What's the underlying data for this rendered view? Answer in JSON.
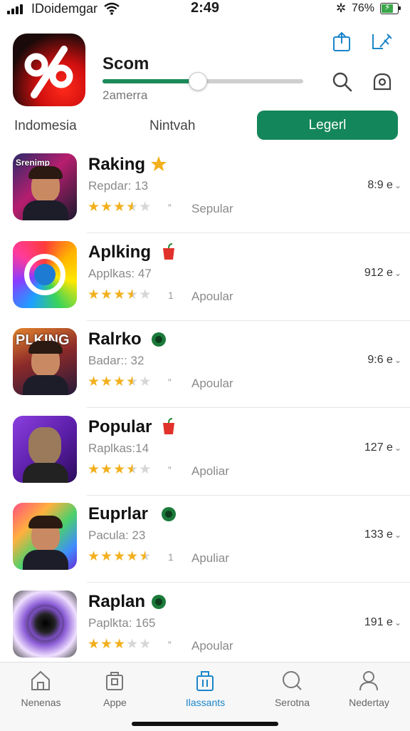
{
  "status_bar": {
    "carrier": "IDoidemgar",
    "time": "2:49",
    "battery_pct": "76%",
    "battery_level": 0.76,
    "icons": [
      "signal-icon",
      "wifi-icon",
      "bluetooth-icon",
      "battery-icon"
    ]
  },
  "header": {
    "app_name": "Scom",
    "subtitle": "2amerra",
    "progress": 0.47,
    "accent": "#14865b",
    "icons": [
      "share-icon",
      "edit-icon",
      "search-icon",
      "tag-icon"
    ]
  },
  "tabs": [
    {
      "label": "Indomesia"
    },
    {
      "label": "Nintvah"
    },
    {
      "label": "Legerl",
      "active": true
    }
  ],
  "list": [
    {
      "title": "Raking",
      "badge": "star",
      "subtitle": "Repdar: 13",
      "rating": 3.5,
      "extra": "”",
      "tag": "Sepular",
      "meta": "8:9 е",
      "thumb_text": "Srenimp"
    },
    {
      "title": "Aplking",
      "badge": "apple",
      "subtitle": "Applkas: 47",
      "rating": 3.5,
      "extra": "1",
      "tag": "Apoular",
      "meta": "912 е",
      "thumb_text": ""
    },
    {
      "title": "Ralrko",
      "badge": "apple",
      "subtitle": "Badar:: 32",
      "rating": 3.5,
      "extra": "”",
      "tag": "Apoular",
      "meta": "9:6 е",
      "thumb_text": "PLKING"
    },
    {
      "title": "Popular",
      "badge": "apple",
      "subtitle": "Raplkas:14",
      "rating": 3.5,
      "extra": "”",
      "tag": "Apoliar",
      "meta": "127 е",
      "thumb_text": ""
    },
    {
      "title": "Euprlar",
      "badge": "apple",
      "subtitle": "Pacula: 23",
      "rating": 4.5,
      "extra": "1",
      "tag": "Apuliar",
      "meta": "133 е",
      "thumb_text": ""
    },
    {
      "title": "Raplan",
      "badge": "apple",
      "subtitle": "Paplkta: 165",
      "rating": 3,
      "extra": "”",
      "tag": "Apoular",
      "meta": "191 е",
      "thumb_text": ""
    }
  ],
  "nav": [
    {
      "label": "Nenenas",
      "icon": "home-icon"
    },
    {
      "label": "Appe",
      "icon": "bag-icon"
    },
    {
      "label": "Ilassants",
      "icon": "shopping-icon",
      "active": true
    },
    {
      "label": "Serotna",
      "icon": "search-icon"
    },
    {
      "label": "Nedertay",
      "icon": "person-icon"
    }
  ]
}
